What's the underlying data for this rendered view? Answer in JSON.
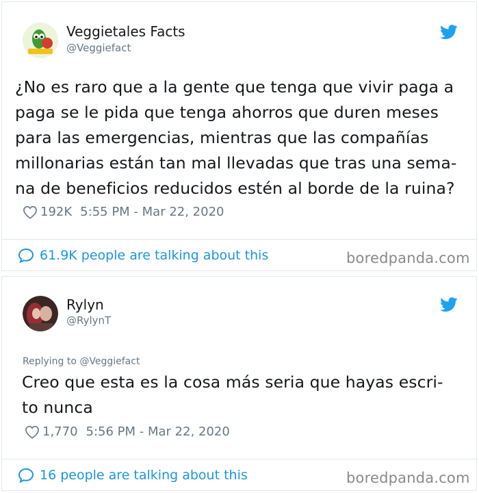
{
  "tweet1": {
    "name": "Veggietales Facts",
    "handle": "@Veggiefact",
    "lines": [
      "¿No es raro que a la gente que tenga que vivir paga a",
      "paga se le pida que tenga ahorros que duren meses",
      "para las emergencias, mientras que las compañías",
      "millonarias están tan mal llevadas que tras una sema-",
      "na de beneficios reducidos estén al borde de la ruina?"
    ],
    "likes": "192K",
    "timestamp": "5:55 PM - Mar 22, 2020",
    "talking": "61.9K people are talking about this",
    "brand": "boredpanda.com"
  },
  "tweet2": {
    "name": "Rylyn",
    "handle": "@RylynT",
    "replying_to": "Replying to @Veggiefact",
    "lines": [
      "Creo que esta es la cosa más seria que hayas escri-",
      "to nunca"
    ],
    "likes": "1,770",
    "timestamp": "5:56 PM - Mar 22, 2020",
    "talking": "16 people are talking about this",
    "brand": "boredpanda.com"
  },
  "colors": {
    "twitter_blue": "#1da1f2",
    "link_blue": "#1b95e0",
    "muted": "#657786",
    "border": "#e1e8ed"
  },
  "icons": [
    "twitter-bird-icon",
    "heart-icon",
    "speech-bubble-icon"
  ]
}
